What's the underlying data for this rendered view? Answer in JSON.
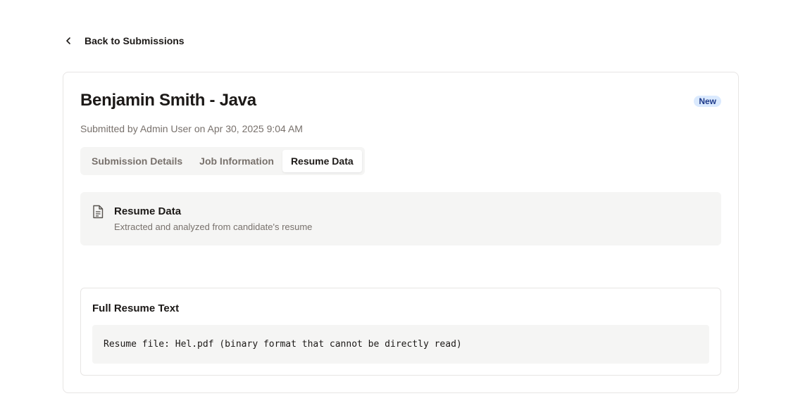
{
  "nav": {
    "back_label": "Back to Submissions",
    "back_icon": "chevron-left-icon"
  },
  "submission": {
    "title": "Benjamin Smith - Java",
    "status_badge": "New",
    "meta": "Submitted by Admin User on Apr 30, 2025 9:04 AM"
  },
  "tabs": [
    {
      "label": "Submission Details",
      "active": false
    },
    {
      "label": "Job Information",
      "active": false
    },
    {
      "label": "Resume Data",
      "active": true
    }
  ],
  "resume_section": {
    "icon": "file-text-icon",
    "title": "Resume Data",
    "description": "Extracted and analyzed from candidate's resume"
  },
  "full_resume": {
    "title": "Full Resume Text",
    "content": "Resume file: Hel.pdf (binary format that cannot be directly read)"
  },
  "colors": {
    "badge_bg": "#dbeafe",
    "badge_text": "#1e3a8a",
    "muted_bg": "#f5f5f4",
    "border": "#e7e5e4",
    "muted_text": "#78716c"
  }
}
